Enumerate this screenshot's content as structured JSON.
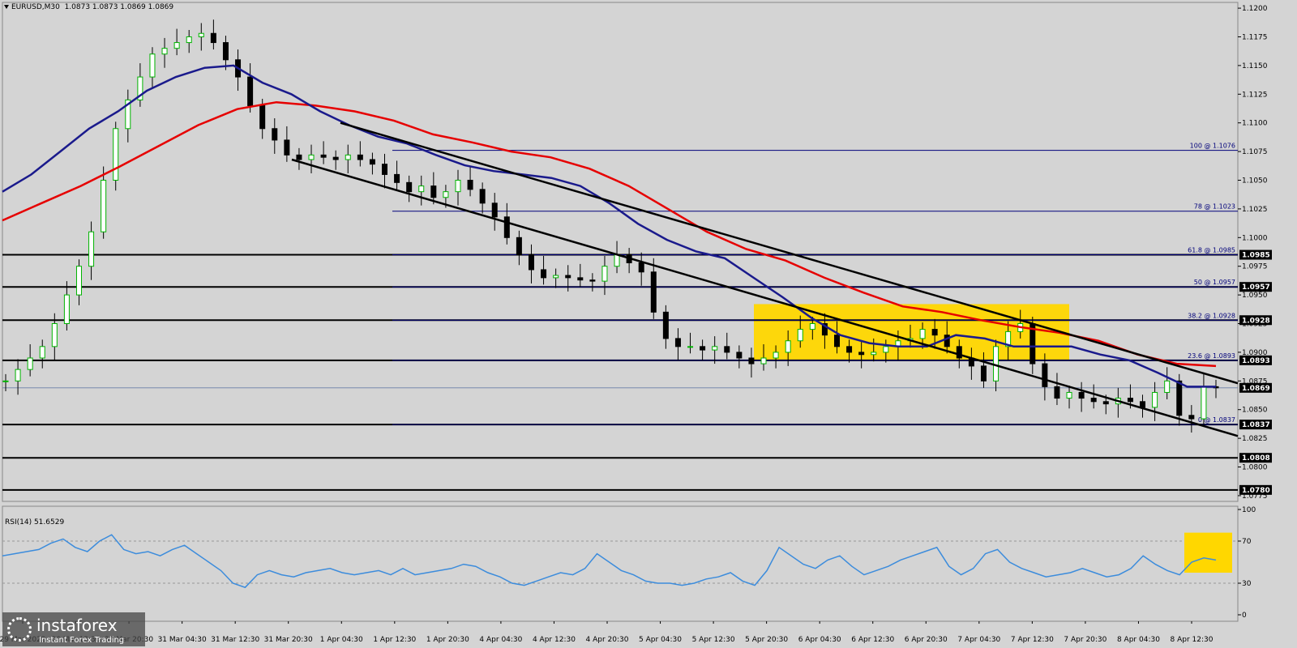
{
  "header": {
    "symbol": "EURUSD,M30",
    "ohlc": "1.0873 1.0873 1.0869 1.0869",
    "dropdown_icon": "triangle-down-icon"
  },
  "rsi_header": "RSI(14) 51.6529",
  "logo": {
    "brand": "instaforex",
    "slogan": "Instant Forex Trading",
    "icon": "instaforex-logo-icon"
  },
  "colors": {
    "background": "#d4d4d4",
    "bull_candle": "#00b400",
    "bear_candle": "#000000",
    "ma_fast": "#1a1a8c",
    "ma_slow": "#e60000",
    "fib_line": "#00007a",
    "rsi_line": "#3c8cdc",
    "highlight": "#ffd700"
  },
  "chart_data": [
    {
      "type": "candlestick",
      "title": "EURUSD,M30",
      "y_ticks": [
        "1.1200",
        "1.1175",
        "1.1150",
        "1.1125",
        "1.1100",
        "1.1075",
        "1.1050",
        "1.1025",
        "1.1000",
        "1.0975",
        "1.0950",
        "1.0925",
        "1.0900",
        "1.0875",
        "1.0850",
        "1.0825",
        "1.0800",
        "1.0775"
      ],
      "ylim": [
        1.077,
        1.1205
      ],
      "x_ticks": [
        "29 Mar 2022",
        "30 Mar 12:30",
        "30 Mar 20:30",
        "31 Mar 04:30",
        "31 Mar 12:30",
        "31 Mar 20:30",
        "1 Apr 04:30",
        "1 Apr 12:30",
        "1 Apr 20:30",
        "4 Apr 04:30",
        "4 Apr 12:30",
        "4 Apr 20:30",
        "5 Apr 04:30",
        "5 Apr 12:30",
        "5 Apr 20:30",
        "6 Apr 04:30",
        "6 Apr 12:30",
        "6 Apr 20:30",
        "7 Apr 04:30",
        "7 Apr 12:30",
        "7 Apr 20:30",
        "8 Apr 04:30",
        "8 Apr 12:30"
      ],
      "close_path": [
        1.0875,
        1.0885,
        1.0895,
        1.0905,
        1.0925,
        1.095,
        1.0975,
        1.1005,
        1.105,
        1.1095,
        1.112,
        1.114,
        1.116,
        1.1165,
        1.117,
        1.1175,
        1.1178,
        1.117,
        1.1155,
        1.114,
        1.1115,
        1.1095,
        1.1085,
        1.1072,
        1.1068,
        1.1072,
        1.107,
        1.1068,
        1.1072,
        1.1068,
        1.1064,
        1.1055,
        1.1048,
        1.104,
        1.1045,
        1.1035,
        1.104,
        1.105,
        1.1042,
        1.103,
        1.1018,
        1.1,
        1.0985,
        1.0972,
        1.0965,
        1.0967,
        1.0965,
        1.0963,
        1.0962,
        1.0975,
        1.0985,
        1.0978,
        1.097,
        1.0935,
        1.0912,
        1.0905,
        1.0905,
        1.0902,
        1.0905,
        1.09,
        1.0895,
        1.089,
        1.0895,
        1.09,
        1.091,
        1.092,
        1.0925,
        1.0915,
        1.0905,
        1.09,
        1.0898,
        1.09,
        1.0905,
        1.091,
        1.0912,
        1.092,
        1.0915,
        1.0905,
        1.0895,
        1.0888,
        1.0875,
        1.0905,
        1.0918,
        1.0925,
        1.089,
        1.087,
        1.086,
        1.0865,
        1.086,
        1.0857,
        1.0855,
        1.086,
        1.0857,
        1.0852,
        1.0865,
        1.0875,
        1.0845,
        1.0842,
        1.087,
        1.0869
      ],
      "series": [
        {
          "name": "MA fast",
          "values": [
            1.104,
            1.1055,
            1.1075,
            1.1095,
            1.111,
            1.1128,
            1.114,
            1.1148,
            1.115,
            1.1135,
            1.1125,
            1.111,
            1.1098,
            1.1088,
            1.1082,
            1.1072,
            1.1063,
            1.1058,
            1.1055,
            1.1052,
            1.1045,
            1.103,
            1.1012,
            1.0998,
            1.0988,
            1.0982,
            1.0965,
            1.0948,
            1.093,
            1.0915,
            1.0908,
            1.0905,
            1.0905,
            1.0915,
            1.0912,
            1.0905,
            1.0905,
            1.0905,
            1.0898,
            1.0893,
            1.0882,
            1.087,
            1.087
          ]
        },
        {
          "name": "MA slow",
          "values": [
            1.1015,
            1.103,
            1.1045,
            1.1062,
            1.108,
            1.1098,
            1.1112,
            1.1118,
            1.1115,
            1.111,
            1.1102,
            1.109,
            1.1083,
            1.1075,
            1.107,
            1.106,
            1.1045,
            1.1025,
            1.1005,
            1.099,
            1.098,
            1.0965,
            1.0952,
            1.094,
            1.0935,
            1.0928,
            1.0922,
            1.0917,
            1.091,
            1.0898,
            1.089,
            1.0888
          ]
        }
      ],
      "channel": {
        "upper": [
          [
            1.11,
            1.0873
          ]
        ],
        "lower": [
          [
            1.1068,
            1.0827
          ]
        ]
      },
      "fibonacci": [
        {
          "label": "100 @ 1.1076",
          "value": 1.1076
        },
        {
          "label": "78 @ 1.1023",
          "value": 1.1023
        },
        {
          "label": "61.8 @ 1.0985",
          "value": 1.0985
        },
        {
          "label": "50 @ 1.0957",
          "value": 1.0957
        },
        {
          "label": "38.2 @ 1.0928",
          "value": 1.0928
        },
        {
          "label": "23.6 @ 1.0893",
          "value": 1.0893
        },
        {
          "label": "0 @ 1.0837",
          "value": 1.0837
        }
      ],
      "levels": [
        {
          "label": "1.0985",
          "value": 1.0985
        },
        {
          "label": "1.0957",
          "value": 1.0957
        },
        {
          "label": "1.0928",
          "value": 1.0928
        },
        {
          "label": "1.0893",
          "value": 1.0893
        },
        {
          "label": "1.0837",
          "value": 1.0837
        },
        {
          "label": "1.0808",
          "value": 1.0808
        },
        {
          "label": "1.0780",
          "value": 1.078
        }
      ],
      "current_price": {
        "label": "1.0869",
        "value": 1.0869
      },
      "highlight_zone": {
        "from": 1.0893,
        "to": 1.0942
      }
    },
    {
      "type": "line",
      "title": "RSI(14) 51.6529",
      "y_ticks": [
        "100",
        "70",
        "30",
        "0"
      ],
      "ylim": [
        0,
        100
      ],
      "levels": [
        70,
        30
      ],
      "values": [
        56,
        58,
        60,
        62,
        68,
        72,
        64,
        60,
        70,
        76,
        62,
        58,
        60,
        56,
        62,
        66,
        58,
        50,
        42,
        30,
        26,
        38,
        42,
        38,
        36,
        40,
        42,
        44,
        40,
        38,
        40,
        42,
        38,
        44,
        38,
        40,
        42,
        44,
        48,
        46,
        40,
        36,
        30,
        28,
        32,
        36,
        40,
        38,
        44,
        58,
        50,
        42,
        38,
        32,
        30,
        30,
        28,
        30,
        34,
        36,
        40,
        32,
        28,
        42,
        64,
        56,
        48,
        44,
        52,
        56,
        46,
        38,
        42,
        46,
        52,
        56,
        60,
        64,
        46,
        38,
        44,
        58,
        62,
        50,
        44,
        40,
        36,
        38,
        40,
        44,
        40,
        36,
        38,
        44,
        56,
        48,
        42,
        38,
        50,
        54,
        52
      ]
    }
  ]
}
